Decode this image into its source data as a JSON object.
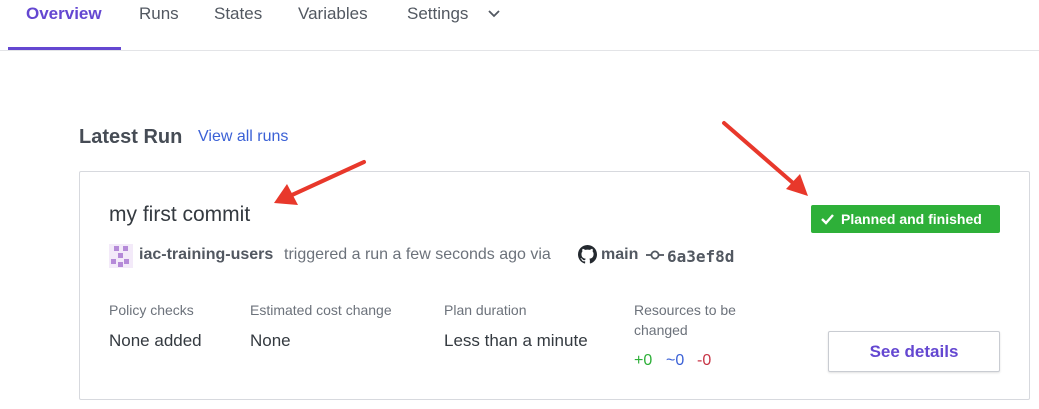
{
  "tabs": [
    {
      "label": "Overview",
      "active": true
    },
    {
      "label": "Runs"
    },
    {
      "label": "States"
    },
    {
      "label": "Variables"
    },
    {
      "label": "Settings"
    }
  ],
  "latest_run": {
    "section_title": "Latest Run",
    "view_all_label": "View all runs",
    "title": "my first commit",
    "status": "Planned and finished",
    "user": "iac-training-users",
    "trigger_text": "triggered a run a few seconds ago via",
    "branch": "main",
    "commit_sha": "6a3ef8d",
    "stats": {
      "policy_checks_label": "Policy checks",
      "policy_checks_value": "None added",
      "cost_change_label": "Estimated cost change",
      "cost_change_value": "None",
      "plan_duration_label": "Plan duration",
      "plan_duration_value": "Less than a minute",
      "resources_label_line1": "Resources to be",
      "resources_label_line2": "changed",
      "resources_add": "+0",
      "resources_change": "~0",
      "resources_destroy": "-0"
    },
    "details_button": "See details"
  },
  "colors": {
    "accent": "#6447d1",
    "link": "#3b61d6",
    "success": "#2eb039",
    "destroy": "#c73445",
    "annotation_arrow": "#e8382b"
  }
}
